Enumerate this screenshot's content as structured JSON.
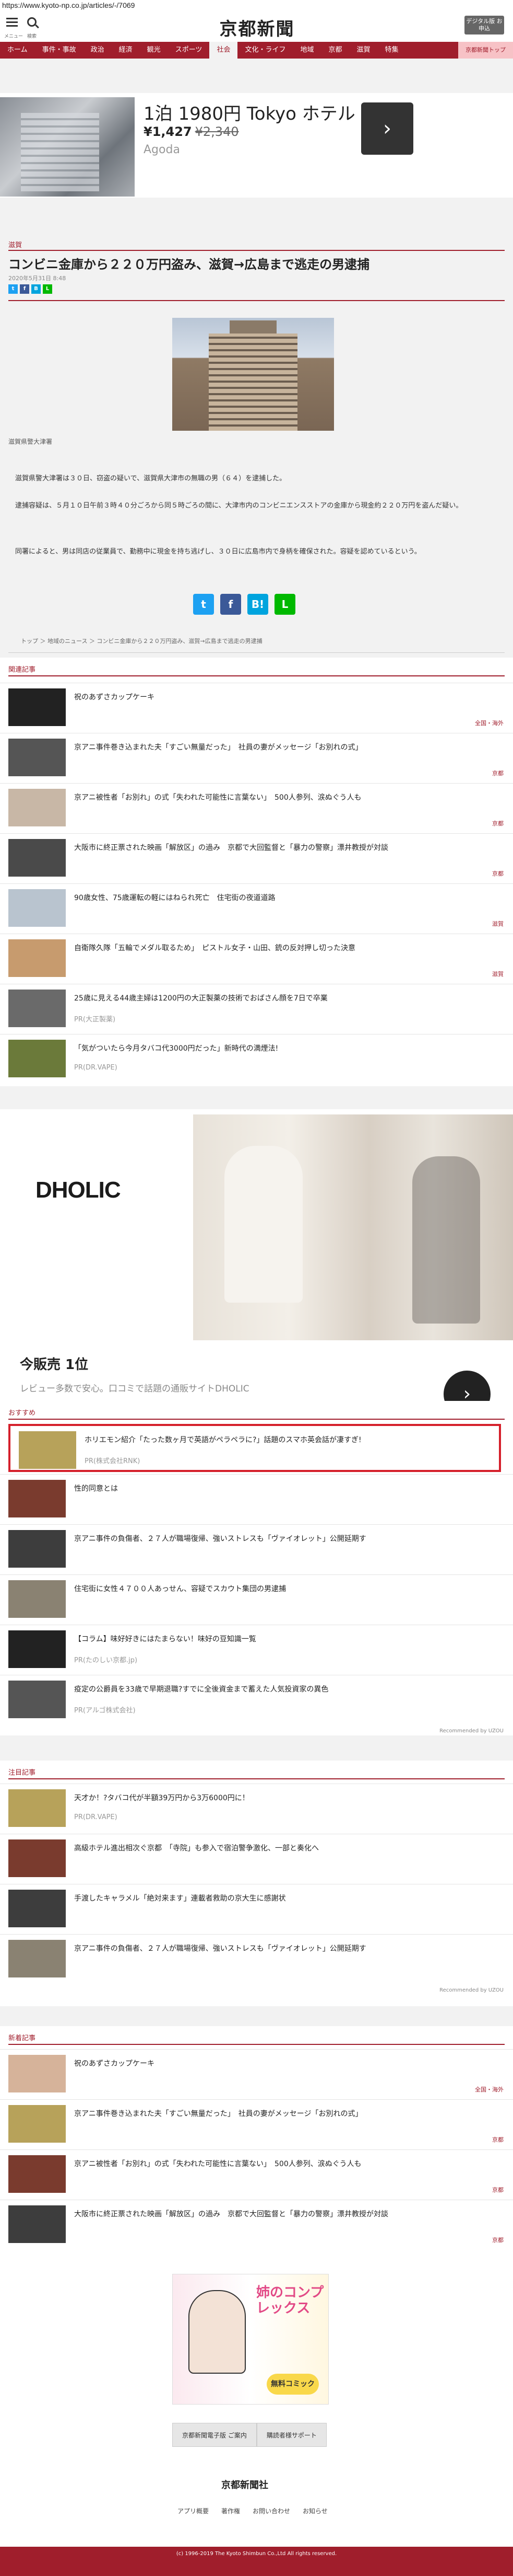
{
  "url": "https://www.kyoto-np.co.jp/articles/-/7069",
  "header": {
    "menu_label": "メニュー",
    "search_label": "検索",
    "logo": "京都新聞",
    "digital_btn": "デジタル版 お申込"
  },
  "nav": {
    "items": [
      "ホーム",
      "事件・事故",
      "政治",
      "経済",
      "観光",
      "スポーツ",
      "社会",
      "文化・ライフ",
      "地域",
      "京都",
      "滋賀",
      "特集",
      "京都新聞トップ"
    ],
    "active_index": 6
  },
  "ad_top": {
    "title": "1泊 1980円 Tokyo ホテル",
    "price": "¥1,427",
    "old_price": "¥2,340",
    "brand": "Agoda"
  },
  "article": {
    "category": "滋賀",
    "headline": "コンビニ金庫から２２０万円盗み、滋賀→広島まで逃走の男逮捕",
    "date": "2020年5月31日 8:48",
    "caption": "滋賀県警大津署",
    "p1": "　滋賀県警大津署は３０日、窃盗の疑いで、滋賀県大津市の無職の男（６４）を逮捕した。",
    "p2": "　逮捕容疑は、５月１０日午前３時４０分ごろから同５時ごろの間に、大津市内のコンビニエンスストアの金庫から現金約２２０万円を盗んだ疑い。",
    "p3": "　同署によると、男は同店の従業員で、勤務中に現金を持ち逃げし、３０日に広島市内で身柄を確保された。容疑を認めているという。",
    "breadcrumb": "トップ ＞ 地域のニュース ＞ コンビニ金庫から２２０万円盗み、滋賀→広島まで逃走の男逮捕"
  },
  "related": {
    "title": "関連記事",
    "rows": [
      {
        "title": "祝のあずさカップケーキ",
        "tag": "全国・海外"
      },
      {
        "title": "京アニ事件巻き込まれた夫「すごい無量だった」　社員の妻がメッセージ「お別れの式」",
        "tag": "京都"
      },
      {
        "title": "京アニ被性者「お別れ」の式「失われた可能性に言葉ない」　500人参列、涙ぬぐう人も",
        "tag": "京都"
      },
      {
        "title": "大阪市に終正票された映画「解放区」の過み　京都で大回監督と「暴力の警察」漂井教授が対談",
        "tag": "京都"
      },
      {
        "title": "90歳女性、75歳運転の軽にはねられ死亡　住宅街の夜道道路",
        "tag": "滋賀"
      },
      {
        "title": "自衛隊久隊「五輪でメダル取るため」　ピストル女子・山田、銃の反対押し切った決意",
        "tag": "滋賀"
      },
      {
        "title": "25歳に見える44歳主婦は1200円の大正製薬の技術でおばさん顔を7日で卒業",
        "pr": "PR(大正製薬)"
      },
      {
        "title": "「気がついたら今月タバコ代3000円だった」新時代の満煙法!",
        "pr": "PR(DR.VAPE)"
      }
    ]
  },
  "ad_mid": {
    "logo": "DHOLIC",
    "rank": "今販売 1位",
    "desc": "レビュー多数で安心。口コミで話題の通販サイトDHOLIC"
  },
  "recommend": {
    "title": "おすすめ",
    "rows": [
      {
        "title": "ホリエモン紹介「たった数ヶ月で英語がペラペラに?」話題のスマホ英会話が凄すぎ!",
        "pr": "PR(株式会社RNK)"
      },
      {
        "title": "性的同意とは"
      },
      {
        "title": "京アニ事件の負傷者、２７人が職場復帰、強いストレスも「ヴァイオレット」公開延期す"
      },
      {
        "title": "住宅街に女性４７００人あっせん、容疑でスカウト集団の男逮捕"
      },
      {
        "title": "【コラム】味好好きにはたまらない！味好の豆知識一覧",
        "pr": "PR(たのしい京都.jp)"
      },
      {
        "title": "疫定の公爵員を33歳で早期退職?すでに全後資金まで蓄えた人気投資家の異色",
        "pr": "PR(アルゴ株式会社)"
      }
    ],
    "sponsored": "Recommended by UZOU"
  },
  "attention": {
    "title": "注目記事",
    "rows": [
      {
        "title": "天才か！?タバコ代が半額39万円から3万6000円に！",
        "pr": "PR(DR.VAPE)"
      },
      {
        "title": "高級ホテル進出相次ぐ京都　「寺院」も参入で宿泊警争激化、一部と奏化へ"
      },
      {
        "title": "手渡したキャラメル「絶対来ます」連載者救助の京大生に感謝状"
      },
      {
        "title": "京アニ事件の負傷者、２７人が職場復帰、強いストレスも「ヴァイオレット」公開延期す"
      }
    ],
    "sponsored": "Recommended by UZOU"
  },
  "latest": {
    "title": "新着記事",
    "rows": [
      {
        "title": "祝のあずさカップケーキ",
        "tag": "全国・海外"
      },
      {
        "title": "京アニ事件巻き込まれた夫「すごい無量だった」　社員の妻がメッセージ「お別れの式」",
        "tag": "京都"
      },
      {
        "title": "京アニ被性者「お別れ」の式「失われた可能性に言葉ない」　500人参列、涙ぬぐう人も",
        "tag": "京都"
      },
      {
        "title": "大阪市に終正票された映画「解放区」の過み　京都で大回監督と「暴力の警察」漂井教授が対談",
        "tag": "京都"
      }
    ]
  },
  "latest_ad": {
    "title": "姉のコンプレックス",
    "badge": "無料コミック"
  },
  "footer": {
    "btn1": "京都新聞電子版 ご案内",
    "btn2": "購読者様サポート",
    "logo": "京都新聞社",
    "links": [
      "アプリ概要",
      "著作権",
      "お問い合わせ",
      "お知らせ"
    ],
    "copyright": "(c) 1996-2019 The Kyoto Shimbun Co.,Ltd All rights reserved."
  }
}
